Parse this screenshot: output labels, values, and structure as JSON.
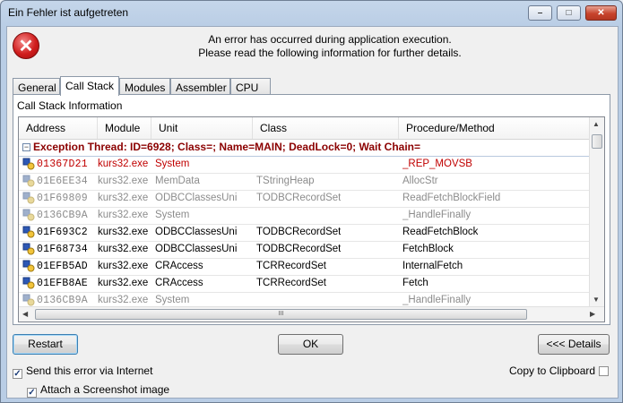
{
  "window": {
    "title": "Ein Fehler ist aufgetreten",
    "controls": {
      "minimize": "–",
      "maximize": "□",
      "close": "✕"
    }
  },
  "message": {
    "line1": "An error has occurred during application execution.",
    "line2": "Please read the following information for further details.",
    "icon": "error-icon"
  },
  "tabs": [
    {
      "label": "General",
      "active": false
    },
    {
      "label": "Call Stack",
      "active": true
    },
    {
      "label": "Modules",
      "active": false
    },
    {
      "label": "Assembler",
      "active": false
    },
    {
      "label": "CPU",
      "active": false
    }
  ],
  "call_stack": {
    "section_label": "Call Stack Information",
    "columns": [
      "Address",
      "Module",
      "Unit",
      "Class",
      "Procedure/Method"
    ],
    "group": {
      "expander": "−",
      "text": "Exception Thread: ID=6928; Class=; Name=MAIN; DeadLock=0; Wait Chain="
    },
    "rows": [
      {
        "address": "01367D21",
        "module": "kurs32.exe",
        "unit": "System",
        "class": "",
        "method": "_REP_MOVSB",
        "style": "red"
      },
      {
        "address": "01E6EE34",
        "module": "kurs32.exe",
        "unit": "MemData",
        "class": "TStringHeap",
        "method": "AllocStr",
        "style": "gray"
      },
      {
        "address": "01F69809",
        "module": "kurs32.exe",
        "unit": "ODBCClassesUni",
        "class": "TODBCRecordSet",
        "method": "ReadFetchBlockField",
        "style": "gray"
      },
      {
        "address": "0136CB9A",
        "module": "kurs32.exe",
        "unit": "System",
        "class": "",
        "method": "_HandleFinally",
        "style": "gray"
      },
      {
        "address": "01F693C2",
        "module": "kurs32.exe",
        "unit": "ODBCClassesUni",
        "class": "TODBCRecordSet",
        "method": "ReadFetchBlock",
        "style": "black"
      },
      {
        "address": "01F68734",
        "module": "kurs32.exe",
        "unit": "ODBCClassesUni",
        "class": "TODBCRecordSet",
        "method": "FetchBlock",
        "style": "black"
      },
      {
        "address": "01EFB5AD",
        "module": "kurs32.exe",
        "unit": "CRAccess",
        "class": "TCRRecordSet",
        "method": "InternalFetch",
        "style": "black"
      },
      {
        "address": "01EFB8AE",
        "module": "kurs32.exe",
        "unit": "CRAccess",
        "class": "TCRRecordSet",
        "method": "Fetch",
        "style": "black"
      },
      {
        "address": "0136CB9A",
        "module": "kurs32.exe",
        "unit": "System",
        "class": "",
        "method": "_HandleFinally",
        "style": "gray"
      }
    ],
    "hscroll_grip": "III"
  },
  "buttons": {
    "restart": "Restart",
    "ok": "OK",
    "details": "<<< Details"
  },
  "options": {
    "send_via_internet": {
      "label": "Send this error via Internet",
      "checked": true
    },
    "attach_screenshot": {
      "label": "Attach a Screenshot image",
      "checked": true
    },
    "copy_to_clipboard": {
      "label": "Copy to Clipboard",
      "checked": false
    }
  }
}
